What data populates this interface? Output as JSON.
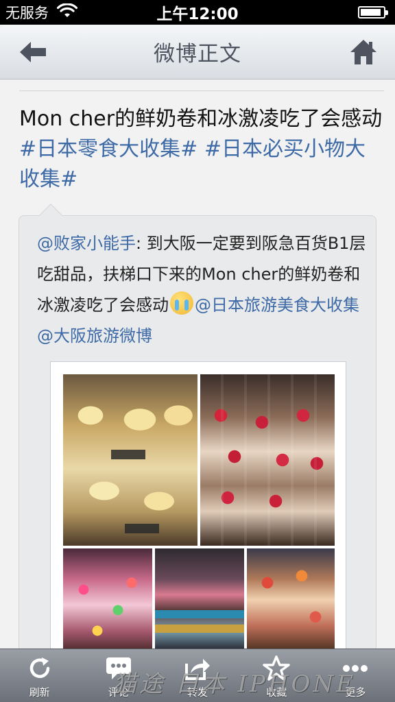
{
  "status_bar": {
    "carrier": "无服务",
    "time": "上午12:00",
    "wifi_icon": "wifi-icon",
    "battery_level": 0.9
  },
  "nav": {
    "title": "微博正文",
    "back_icon": "back-arrow-icon",
    "home_icon": "home-icon"
  },
  "post": {
    "text_plain": "Mon cher的鲜奶卷和冰激凌吃了会感动",
    "hashtag1": "#日本零食大收集#",
    "space": " ",
    "hashtag2": "#日本必买小物大收集#"
  },
  "retweet": {
    "author": "@败家小能手",
    "text1": ": 到大阪一定要到阪急百货B1层吃甜品，扶梯口下来的Mon cher的鲜奶卷和冰激凌吃了会感动",
    "emoji": "cry-emoji",
    "mention1": "@日本旅游美食大收集",
    "mention2": "@大阪旅游微博"
  },
  "toolbar": {
    "items": [
      {
        "label": "刷新",
        "icon": "refresh-icon"
      },
      {
        "label": "评论",
        "icon": "comment-icon"
      },
      {
        "label": "转发",
        "icon": "share-icon"
      },
      {
        "label": "收藏",
        "icon": "star-icon"
      },
      {
        "label": "更多",
        "icon": "more-icon"
      }
    ]
  },
  "watermark": "猫途 日本 IPHONE",
  "colors": {
    "link": "#3d6aa6",
    "nav_title": "#4d5460",
    "toolbar_top": "#9a9fa6",
    "toolbar_bottom": "#6b7079"
  }
}
